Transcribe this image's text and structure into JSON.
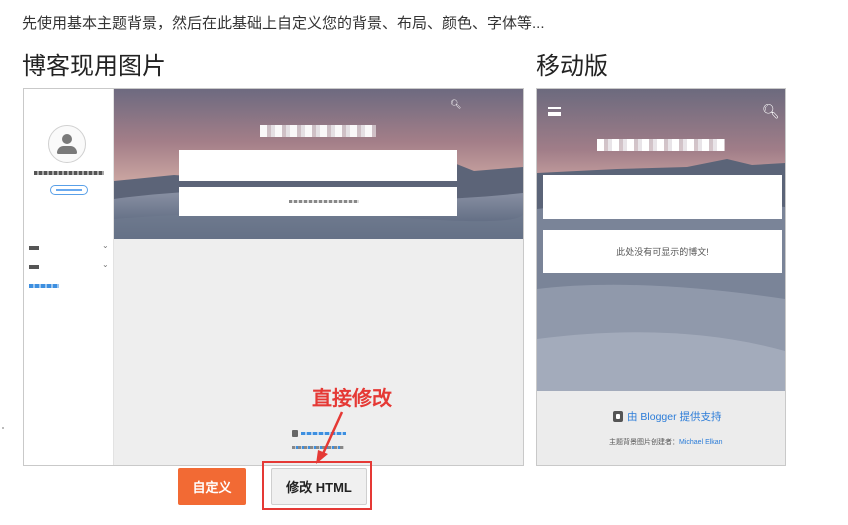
{
  "intro_text": "先使用基本主题背景，然后在此基础上自定义您的背景、布局、颜色、字体等...",
  "desktop_heading": "博客现用图片",
  "mobile_heading": "移动版",
  "mobile_preview": {
    "empty_message": "此处没有可显示的博文!",
    "powered_by": "由 Blogger 提供支持",
    "credit_prefix": "主题背景图片创建者：",
    "credit_author": "Michael Elkan"
  },
  "buttons": {
    "customize": "自定义",
    "edit_html": "修改 HTML"
  },
  "annotation": "直接修改",
  "colors": {
    "primary_button": "#f26a34",
    "annotation_red": "#e53935",
    "link_blue": "#2b7cd8"
  },
  "icons": [
    "search-icon",
    "menu-icon",
    "avatar-icon",
    "blogger-logo-icon",
    "chevron-down-icon"
  ]
}
